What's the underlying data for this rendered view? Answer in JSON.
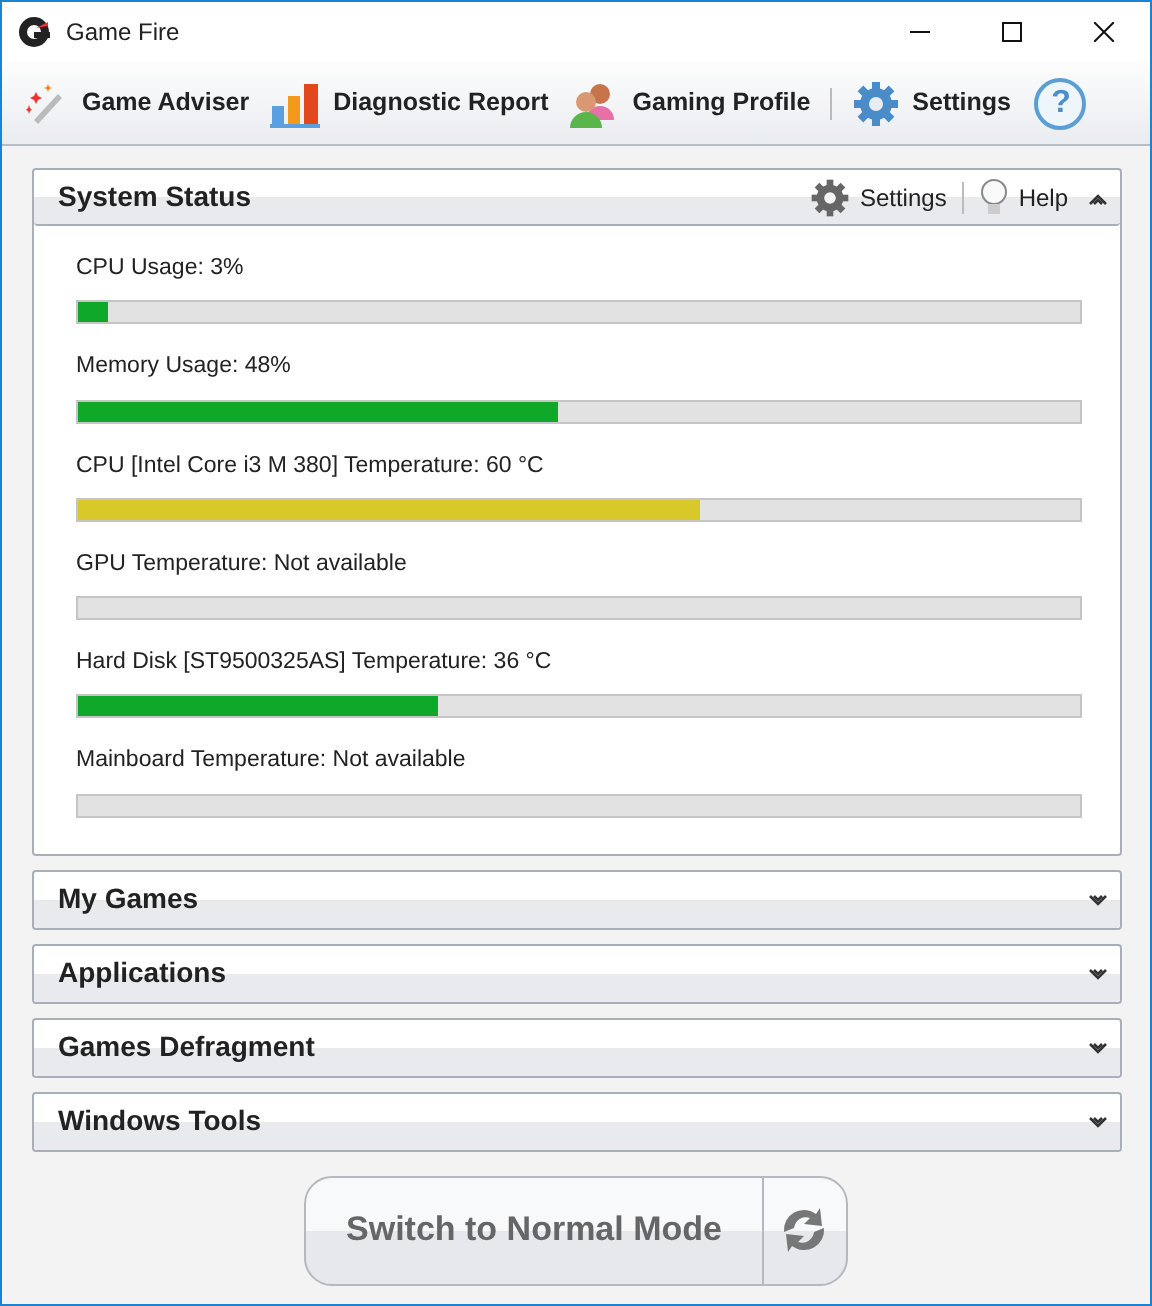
{
  "window": {
    "title": "Game Fire"
  },
  "toolbar": [
    {
      "kind": "adviser",
      "label": "Game Adviser"
    },
    {
      "kind": "report",
      "label": "Diagnostic Report"
    },
    {
      "kind": "profile",
      "label": "Gaming Profile"
    },
    {
      "kind": "settings",
      "label": "Settings"
    },
    {
      "kind": "help",
      "label": "?"
    }
  ],
  "sections": [
    {
      "title": "System Status",
      "expanded": true,
      "actions": [
        "Settings",
        "Help"
      ],
      "meters": [
        {
          "label": "CPU Usage: 3%",
          "level": 0.03,
          "color": "#10a829"
        },
        {
          "label": "Memory Usage: 48%",
          "level": 0.48,
          "color": "#10a829"
        },
        {
          "label": "CPU [Intel Core i3 M 380] Temperature: 60 °C",
          "level": 0.62,
          "color": "#d9c82a"
        },
        {
          "label": "GPU Temperature: Not available"
        },
        {
          "label": "Hard Disk [ST9500325AS] Temperature: 36 °C",
          "level": 0.36,
          "color": "#10a829"
        },
        {
          "label": "Mainboard Temperature: Not available"
        }
      ]
    },
    {
      "title": "My Games",
      "expanded": false
    },
    {
      "title": "Applications",
      "expanded": false
    },
    {
      "title": "Games Defragment",
      "expanded": false
    },
    {
      "title": "Windows Tools",
      "expanded": false
    }
  ],
  "mode_button": {
    "label": "Switch to Normal Mode"
  }
}
